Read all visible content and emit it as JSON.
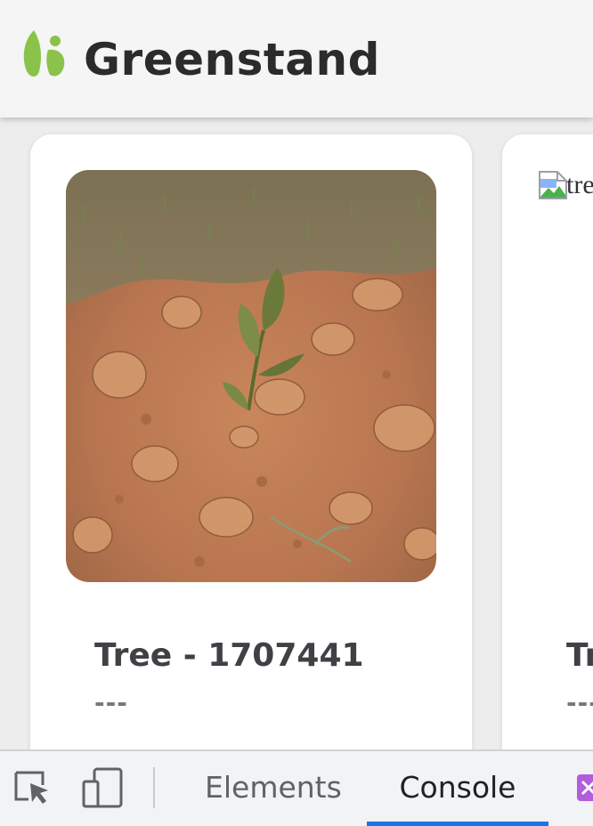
{
  "header": {
    "brand_name": "Greenstand",
    "logo_icon": "greenstand-leaf-logo",
    "logo_color": "#8bc34a"
  },
  "cards": [
    {
      "title": "Tree - 1707441",
      "subtitle": "---",
      "image_alt": "tree photo"
    },
    {
      "title": "Tr",
      "subtitle": "---",
      "image_alt": "tre",
      "image_broken": true
    }
  ],
  "devtools": {
    "icons": [
      "inspect-element-icon",
      "device-toolbar-icon"
    ],
    "tabs": [
      {
        "label": "Elements",
        "active": false
      },
      {
        "label": "Console",
        "active": true
      }
    ],
    "active_tab_color": "#1a73e8"
  }
}
